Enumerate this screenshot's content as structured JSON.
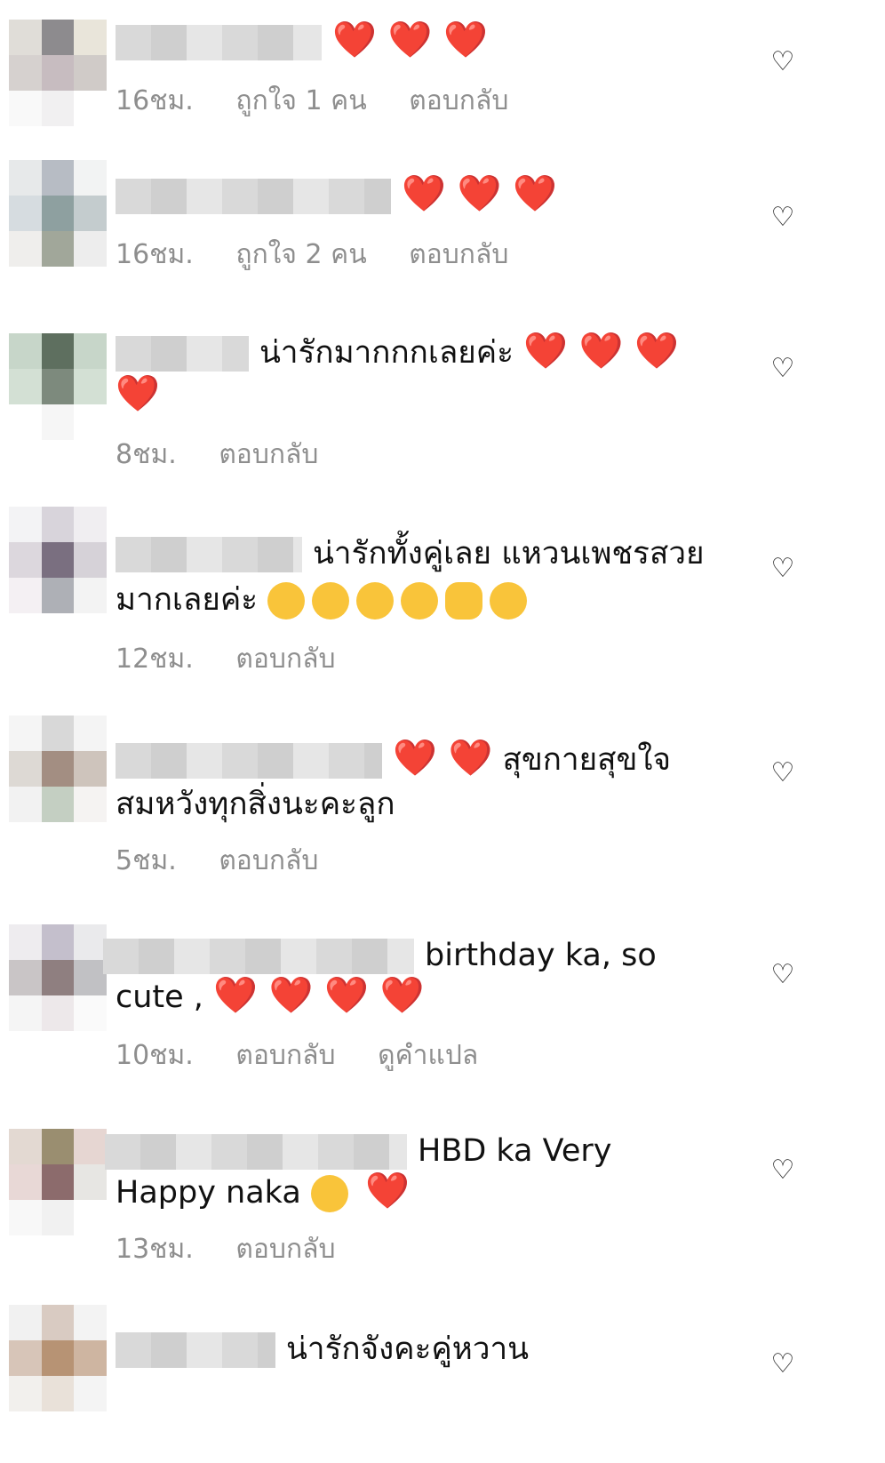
{
  "comments": [
    {
      "text1": "",
      "text2": "",
      "hearts": "❤️ ❤️ ❤️",
      "time": "16ชม.",
      "likes": "ถูกใจ 1 คน",
      "reply": "ตอบกลับ"
    },
    {
      "text1": "",
      "text2": "",
      "hearts": "❤️ ❤️ ❤️",
      "time": "16ชม.",
      "likes": "ถูกใจ 2 คน",
      "reply": "ตอบกลับ"
    },
    {
      "text1": "น่ารักมากกกเลยค่ะ",
      "hearts": "❤️ ❤️ ❤️",
      "hearts2": "❤️",
      "time": "8ชม.",
      "reply": "ตอบกลับ"
    },
    {
      "text1": "น่ารักทั้งคู่เลย แหวนเพชรสวย",
      "text2": "มากเลยค่ะ",
      "time": "12ชม.",
      "reply": "ตอบกลับ"
    },
    {
      "hearts": "❤️ ❤️",
      "text1": "สุขกายสุขใจ",
      "text2": "สมหวังทุกสิ่งนะคะลูก",
      "time": "5ชม.",
      "reply": "ตอบกลับ"
    },
    {
      "text1": "birthday ka, so",
      "text2": "cute ,",
      "hearts2": "❤️ ❤️ ❤️ ❤️",
      "time": "10ชม.",
      "reply": "ตอบกลับ",
      "translate": "ดูคำแปล"
    },
    {
      "text1": "HBD ka Very",
      "text2": "Happy naka",
      "hearts2": "❤️",
      "time": "13ชม.",
      "reply": "ตอบกลับ"
    },
    {
      "text1": "น่ารักจังคะคู่หวาน"
    }
  ],
  "icons": {
    "like": "heart-outline-icon"
  }
}
